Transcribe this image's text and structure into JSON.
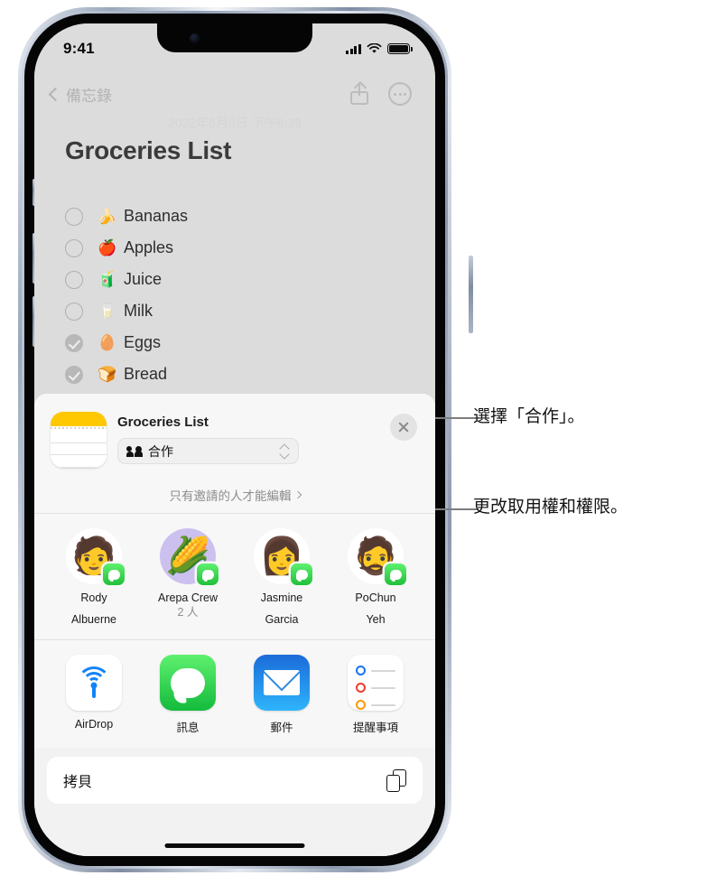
{
  "status_bar": {
    "time": "9:41",
    "signal_icon": "cellular-signal-icon",
    "wifi_icon": "wifi-icon",
    "battery_icon": "battery-icon"
  },
  "nav_bar": {
    "back_label": "備忘錄",
    "back_icon": "chevron-left-icon",
    "share_icon": "share-icon",
    "more_icon": "ellipsis-circle-icon"
  },
  "note": {
    "date": "2022年6月8日 下午8:39",
    "title": "Groceries List",
    "items": [
      {
        "label": "Bananas",
        "emoji": "🍌",
        "checked": false
      },
      {
        "label": "Apples",
        "emoji": "🍎",
        "checked": false
      },
      {
        "label": "Juice",
        "emoji": "🧃",
        "checked": false
      },
      {
        "label": "Milk",
        "emoji": "🥛",
        "checked": false
      },
      {
        "label": "Eggs",
        "emoji": "🥚",
        "checked": true
      },
      {
        "label": "Bread",
        "emoji": "🍞",
        "checked": true
      }
    ]
  },
  "share_sheet": {
    "doc_icon": "notes-app-icon",
    "doc_title": "Groceries List",
    "collaborate": {
      "label": "合作",
      "icon": "people-icon",
      "selector_icon": "up-down-chevron-icon"
    },
    "permissions": {
      "label": "只有邀請的人才能編輯",
      "chevron_icon": "chevron-right-icon"
    },
    "close_icon": "close-icon",
    "contacts": [
      {
        "name": "Rody\nAlbuerne",
        "line1": "Rody",
        "line2": "Albuerne",
        "sub": "",
        "avatar": "🧑",
        "badge": "messages-badge-icon",
        "group": false
      },
      {
        "name": "Arepa Crew",
        "line1": "Arepa Crew",
        "line2": "",
        "sub": "2 人",
        "avatar": "🌽",
        "badge": "messages-badge-icon",
        "group": true
      },
      {
        "name": "Jasmine Garcia",
        "line1": "Jasmine",
        "line2": "Garcia",
        "sub": "",
        "avatar": "👩",
        "badge": "messages-badge-icon",
        "group": false
      },
      {
        "name": "PoChun Yeh",
        "line1": "PoChun",
        "line2": "Yeh",
        "sub": "",
        "avatar": "🧔",
        "badge": "messages-badge-icon",
        "group": false
      }
    ],
    "apps": [
      {
        "label": "AirDrop",
        "icon": "airdrop-icon"
      },
      {
        "label": "訊息",
        "icon": "messages-icon"
      },
      {
        "label": "郵件",
        "icon": "mail-icon"
      },
      {
        "label": "提醒事項",
        "icon": "reminders-icon"
      }
    ],
    "copy": {
      "label": "拷貝",
      "icon": "copy-icon"
    }
  },
  "callouts": [
    {
      "text": "選擇「合作」。"
    },
    {
      "text": "更改取用權和權限。"
    }
  ],
  "colors": {
    "note_background": "#dcdcdc",
    "sheet_background": "#f7f7f7",
    "notes_accent": "#ffc800",
    "messages_green": "#22c03a",
    "mail_blue": "#1b6bd9",
    "airdrop_blue": "#1284f7",
    "callout_line": "#7d7d7d"
  }
}
